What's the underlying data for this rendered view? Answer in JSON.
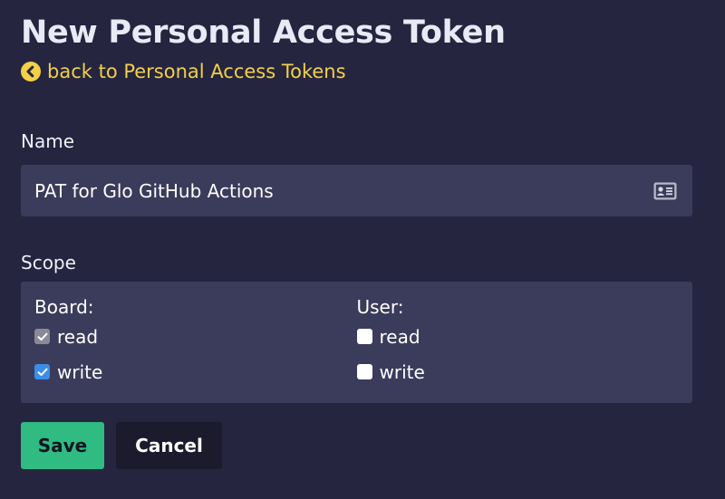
{
  "page": {
    "title": "New Personal Access Token",
    "back_link": "back to Personal Access Tokens"
  },
  "form": {
    "name_label": "Name",
    "name_value": "PAT for Glo GitHub Actions",
    "scope_label": "Scope",
    "scopes": {
      "board": {
        "title": "Board:",
        "read": {
          "label": "read",
          "checked": true,
          "disabled": true
        },
        "write": {
          "label": "write",
          "checked": true,
          "disabled": false
        }
      },
      "user": {
        "title": "User:",
        "read": {
          "label": "read",
          "checked": false,
          "disabled": false
        },
        "write": {
          "label": "write",
          "checked": false,
          "disabled": false
        }
      }
    }
  },
  "actions": {
    "save_label": "Save",
    "cancel_label": "Cancel"
  },
  "colors": {
    "background": "#252540",
    "panel": "#3b3b5b",
    "link": "#f2d048",
    "save": "#2fbb82",
    "checkbox_checked": "#3a8ee6"
  },
  "icons": {
    "back": "chevron-left-circle-icon",
    "name_field": "id-card-icon",
    "check": "checkmark-icon"
  }
}
